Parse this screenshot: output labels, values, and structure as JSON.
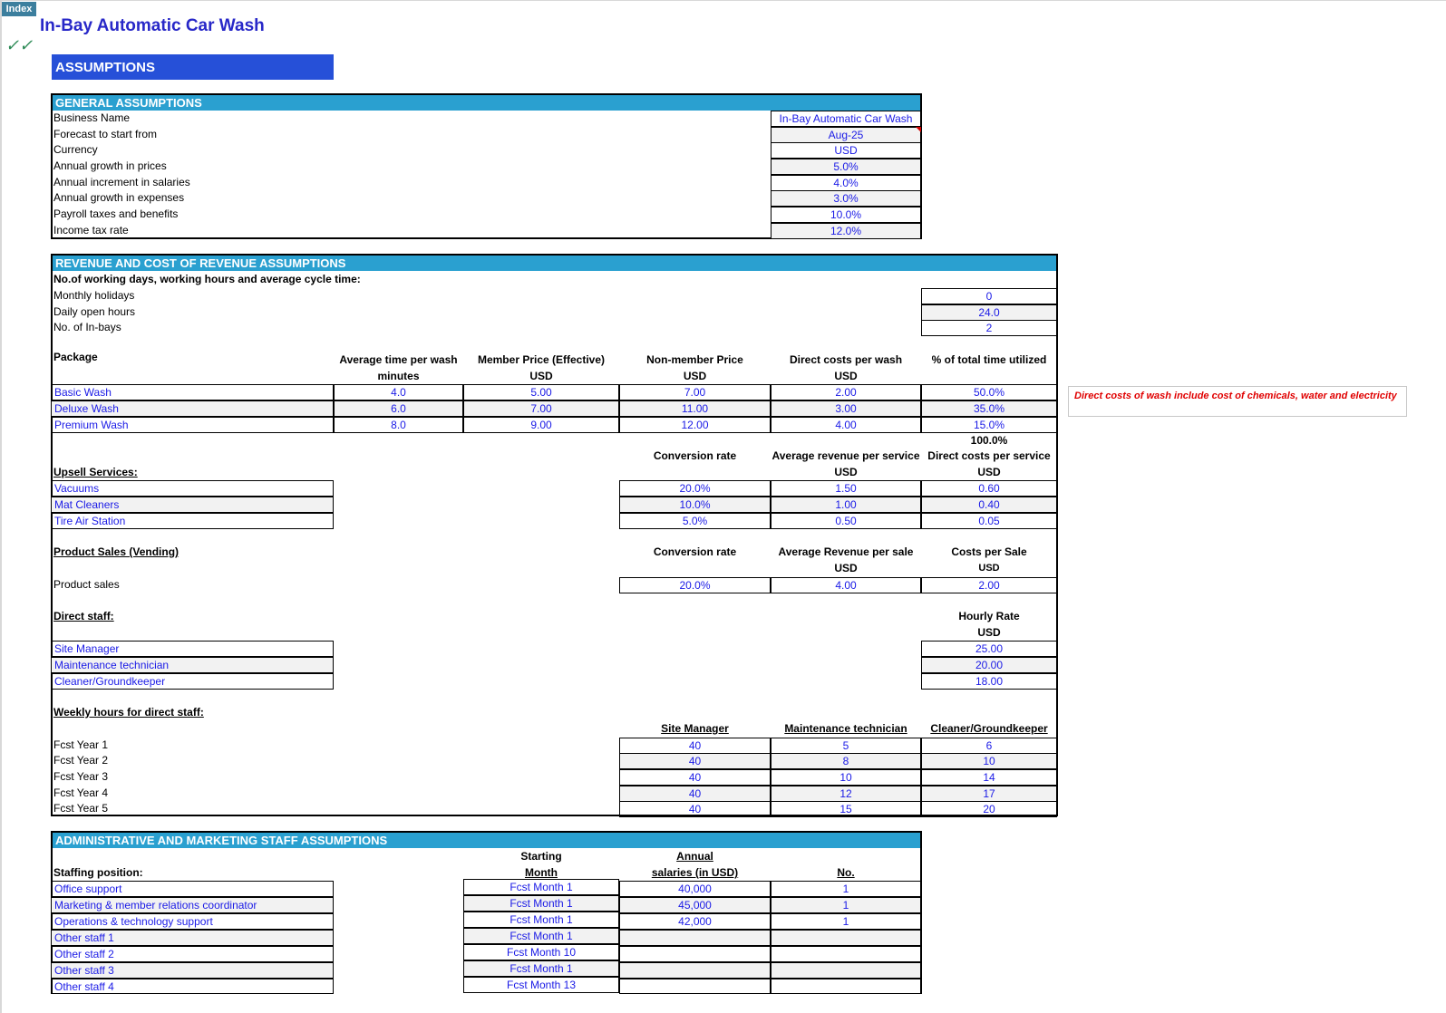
{
  "sheet": {
    "index_button": "Index",
    "check_mark": "✓✓",
    "title": "In-Bay Automatic Car Wash",
    "banner": "ASSUMPTIONS"
  },
  "general": {
    "header": "GENERAL ASSUMPTIONS",
    "rows": [
      {
        "label": "Business Name",
        "value": "In-Bay Automatic Car Wash"
      },
      {
        "label": "Forecast to start from",
        "value": "Aug-25"
      },
      {
        "label": "Currency",
        "value": "USD"
      },
      {
        "label": "Annual growth in prices",
        "value": "5.0%"
      },
      {
        "label": "Annual increment in salaries",
        "value": "4.0%"
      },
      {
        "label": "Annual growth in expenses",
        "value": "3.0%"
      },
      {
        "label": "Payroll taxes and benefits",
        "value": "10.0%"
      },
      {
        "label": "Income tax rate",
        "value": "12.0%"
      }
    ]
  },
  "revenue": {
    "header": "REVENUE AND COST OF REVENUE ASSUMPTIONS",
    "working_title": "No.of  working days, working hours and average cycle time:",
    "working_rows": [
      {
        "label": "Monthly holidays",
        "value": "0"
      },
      {
        "label": "Daily open hours",
        "value": "24.0"
      },
      {
        "label": "No. of In-bays",
        "value": "2"
      }
    ],
    "package": {
      "label": "Package",
      "col_headers": [
        "Average time per wash",
        "Member Price (Effective)",
        "Non-member Price",
        "Direct costs per wash",
        "% of total time utilized"
      ],
      "col_units": [
        "minutes",
        "USD",
        "USD",
        "USD",
        ""
      ],
      "rows": [
        {
          "name": "Basic Wash",
          "time": "4.0",
          "member": "5.00",
          "nonmember": "7.00",
          "cost": "2.00",
          "pct": "50.0%"
        },
        {
          "name": "Deluxe Wash",
          "time": "6.0",
          "member": "7.00",
          "nonmember": "11.00",
          "cost": "3.00",
          "pct": "35.0%"
        },
        {
          "name": "Premium Wash",
          "time": "8.0",
          "member": "9.00",
          "nonmember": "12.00",
          "cost": "4.00",
          "pct": "15.0%"
        }
      ],
      "total_pct": "100.0%"
    },
    "note": "Direct costs of wash include cost of chemicals, water and electricity",
    "upsell": {
      "label": "Upsell Services:",
      "col_headers": [
        "Conversion rate",
        "Average revenue per service",
        "Direct costs per service"
      ],
      "col_units": [
        "",
        "USD",
        "USD"
      ],
      "rows": [
        {
          "name": "Vacuums",
          "conv": "20.0%",
          "rev": "1.50",
          "cost": "0.60"
        },
        {
          "name": "Mat Cleaners",
          "conv": "10.0%",
          "rev": "1.00",
          "cost": "0.40"
        },
        {
          "name": "Tire Air Station",
          "conv": "5.0%",
          "rev": "0.50",
          "cost": "0.05"
        }
      ]
    },
    "product": {
      "label": "Product Sales (Vending)",
      "col_headers": [
        "Conversion rate",
        "Average Revenue per sale",
        "Costs per Sale"
      ],
      "col_units": [
        "",
        "USD",
        "USD"
      ],
      "row": {
        "name": "Product sales",
        "conv": "20.0%",
        "rev": "4.00",
        "cost": "2.00"
      }
    },
    "direct_staff": {
      "label": "Direct staff:",
      "col_header": "Hourly Rate",
      "col_unit": "USD",
      "rows": [
        {
          "name": "Site Manager",
          "rate": "25.00"
        },
        {
          "name": "Maintenance technician",
          "rate": "20.00"
        },
        {
          "name": "Cleaner/Groundkeeper",
          "rate": "18.00"
        }
      ]
    },
    "weekly": {
      "label": "Weekly hours for direct staff:",
      "col_headers": [
        "Site Manager",
        "Maintenance technician",
        "Cleaner/Groundkeeper"
      ],
      "rows": [
        {
          "year": "Fcst Year 1",
          "v": [
            "40",
            "5",
            "6"
          ]
        },
        {
          "year": "Fcst Year 2",
          "v": [
            "40",
            "8",
            "10"
          ]
        },
        {
          "year": "Fcst Year 3",
          "v": [
            "40",
            "10",
            "14"
          ]
        },
        {
          "year": "Fcst Year 4",
          "v": [
            "40",
            "12",
            "17"
          ]
        },
        {
          "year": "Fcst Year 5",
          "v": [
            "40",
            "15",
            "20"
          ]
        }
      ]
    }
  },
  "admin": {
    "header": "ADMINISTRATIVE AND MARKETING STAFF ASSUMPTIONS",
    "position_label": "Staffing position:",
    "start_header": [
      "Starting",
      "Month"
    ],
    "salary_header": [
      "Annual",
      "salaries (in USD)"
    ],
    "no_header": "No.",
    "rows": [
      {
        "name": "Office support",
        "start": "Fcst Month 1",
        "salary": "40,000",
        "no": "1"
      },
      {
        "name": "Marketing & member relations coordinator",
        "start": "Fcst Month 1",
        "salary": "45,000",
        "no": "1"
      },
      {
        "name": "Operations & technology support",
        "start": "Fcst Month 1",
        "salary": "42,000",
        "no": "1"
      },
      {
        "name": "Other staff 1",
        "start": "Fcst Month 1",
        "salary": "",
        "no": ""
      },
      {
        "name": "Other staff 2",
        "start": "Fcst Month 10",
        "salary": "",
        "no": ""
      },
      {
        "name": "Other staff 3",
        "start": "Fcst Month 1",
        "salary": "",
        "no": ""
      },
      {
        "name": "Other staff 4",
        "start": "Fcst Month 13",
        "salary": "",
        "no": ""
      }
    ]
  },
  "colors": {
    "section_header": "#2aa0d0",
    "banner": "#2650d8",
    "title": "#2828c8",
    "input_text": "#1a1ae6",
    "note_text": "#e00000",
    "check": "#2e8b57"
  }
}
